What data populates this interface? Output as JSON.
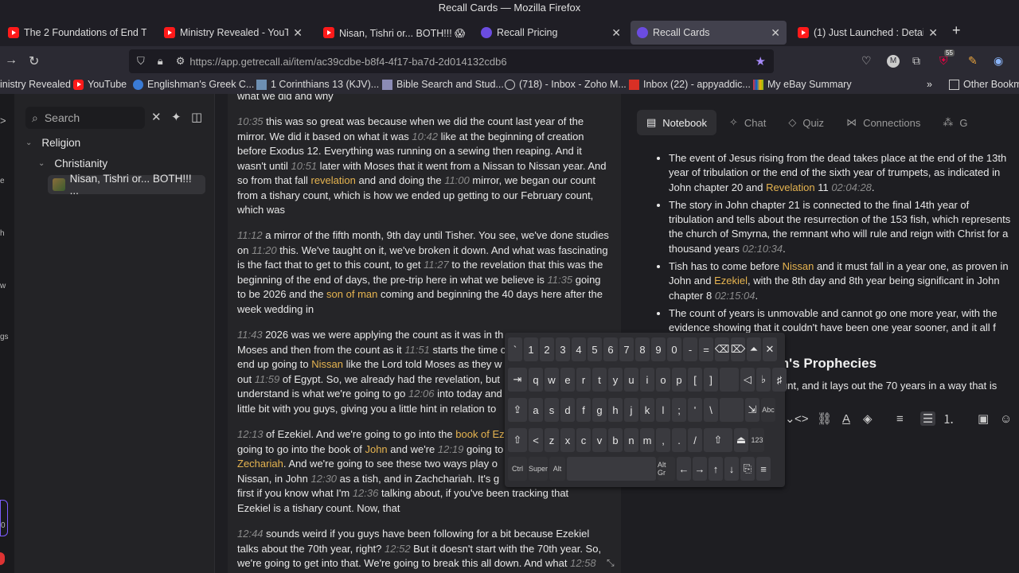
{
  "window_title": "Recall Cards — Mozilla Firefox",
  "tabs": [
    {
      "label": "The 2 Foundations of End T",
      "icon": "youtube-icon"
    },
    {
      "label": "Ministry Revealed - YouTube",
      "icon": "youtube-icon"
    },
    {
      "label": "Nisan, Tishri or... BOTH!!! 😱",
      "icon": "youtube-icon"
    },
    {
      "label": "Recall Pricing",
      "icon": "recall-icon"
    },
    {
      "label": "Recall Cards",
      "icon": "recall-icon"
    },
    {
      "label": "(1) Just Launched : Detailed",
      "icon": "youtube-icon"
    }
  ],
  "url": "https://app.getrecall.ai/item/ac39cdbe-b8f4-4f17-ba7d-2d014132cdb6",
  "bookmarks": [
    "inistry Revealed",
    "YouTube",
    "Englishman's Greek C...",
    "1 Corinthians 13 (KJV)...",
    "Bible Search and Stud...",
    "(718) - Inbox - Zoho M...",
    "Inbox (22) - appyaddic...",
    "My eBay Summary",
    "Other Bookm"
  ],
  "badge_count": "55",
  "rail_labels": [
    "e",
    "h",
    "w",
    "gs",
    "0"
  ],
  "sidebar": {
    "search_placeholder": "Search",
    "tree": [
      {
        "label": "Religion"
      },
      {
        "label": "Christianity"
      },
      {
        "label": "Nisan, Tishri or... BOTH!!! ..."
      }
    ]
  },
  "transcript": {
    "top_fragment": "what we did and why",
    "paragraphs": [
      [
        {
          "ts": "10:35"
        },
        {
          "t": " this was so great was because when we did the count last year of the mirror. We did it based on what it was "
        },
        {
          "ts": "10:42"
        },
        {
          "t": " like at the beginning of creation before Exodus 12. Everything was running on a sewing then reaping. And it wasn't until "
        },
        {
          "ts": "10:51"
        },
        {
          "t": " later with Moses that it went from a Nissan to Nissan year. And so from that fall "
        },
        {
          "hl": "revelation"
        },
        {
          "t": " and and doing the "
        },
        {
          "ts": "11:00"
        },
        {
          "t": " mirror, we began our count from a tishary count, which is how we ended up getting to our February count, which was"
        }
      ],
      [
        {
          "ts": "11:12"
        },
        {
          "t": " a mirror of the fifth month, 9th day until Tisher. You see, we've done studies on "
        },
        {
          "ts": "11:20"
        },
        {
          "t": " this. We've taught on it, we've broken it down. And what was fascinating is the fact that to get to this count, to get "
        },
        {
          "ts": "11:27"
        },
        {
          "t": " to the revelation that this was the beginning of the end of days, the pre-trip here in what we believe is "
        },
        {
          "ts": "11:35"
        },
        {
          "t": " going to be 2026 and the "
        },
        {
          "hl": "son of man"
        },
        {
          "t": " coming and beginning the 40 days here after the week wedding in"
        }
      ],
      [
        {
          "ts": "11:43"
        },
        {
          "t": " 2026 was we were applying the count as it was in th"
        },
        {
          "t": "\nMoses and then from the count as it "
        },
        {
          "ts": "11:51"
        },
        {
          "t": " starts the time c"
        },
        {
          "t": "\nend up going to "
        },
        {
          "hl": "Nissan"
        },
        {
          "t": " like the Lord told Moses as they w"
        },
        {
          "t": "\nout "
        },
        {
          "ts": "11:59"
        },
        {
          "t": " of Egypt. So, we already had the revelation, but"
        },
        {
          "t": "\nunderstand is what we're going to go "
        },
        {
          "ts": "12:06"
        },
        {
          "t": " into today and"
        },
        {
          "t": "\nlittle bit with you guys, giving you a little hint in relation to"
        }
      ],
      [
        {
          "ts": "12:13"
        },
        {
          "t": " of Ezekiel. And we're going to go into the "
        },
        {
          "hl": "book of Ez"
        },
        {
          "t": "\ngoing to go into the book of "
        },
        {
          "hl": "John"
        },
        {
          "t": " and we're "
        },
        {
          "ts": "12:19"
        },
        {
          "t": " going to"
        },
        {
          "t": "\n"
        },
        {
          "hl": "Zechariah"
        },
        {
          "t": ". And we're going to see these two ways play o"
        },
        {
          "t": "\nNissan, in John "
        },
        {
          "ts": "12:30"
        },
        {
          "t": " as a tish, and in Zachchariah. It's g"
        },
        {
          "t": "\nfirst if you know what I'm "
        },
        {
          "ts": "12:36"
        },
        {
          "t": " talking about, if you've been tracking that"
        },
        {
          "t": "\nEzekiel is a tishary count. Now, that"
        }
      ],
      [
        {
          "ts": "12:44"
        },
        {
          "t": " sounds weird if you guys have been following for a bit because Ezekiel talks about the 70th year, right? "
        },
        {
          "ts": "12:52"
        },
        {
          "t": " But it doesn't start with the 70th year. So, we're going to get into that. We're going to break this all down. And what "
        },
        {
          "ts": "12:58"
        }
      ]
    ]
  },
  "right_tabs": [
    "Notebook",
    "Chat",
    "Quiz",
    "Connections",
    "G"
  ],
  "notes": {
    "bullets": [
      [
        {
          "t": "The event of Jesus rising from the dead takes place at the end of the 13th year of tribulation or the end of the sixth year of trumpets, as indicated in John chapter 20 and "
        },
        {
          "hl": "Revelation"
        },
        {
          "t": " 11 "
        },
        {
          "ts": "02:04:28"
        },
        {
          "t": "."
        }
      ],
      [
        {
          "t": "The story in John chapter 21 is connected to the final 14th year of tribulation and tells about the resurrection of the 153 fish, which represents the church of Smyrna, the remnant who will rule and reign with Christ for a thousand years "
        },
        {
          "ts": "02:10:34"
        },
        {
          "t": "."
        }
      ],
      [
        {
          "t": "Tish has to come before "
        },
        {
          "hl": "Nissan"
        },
        {
          "t": " and it must fall in a year one, as proven in John and "
        },
        {
          "hl": "Ezekiel"
        },
        {
          "t": ", with the 8th day and 8th year being significant in John chapter 8 "
        },
        {
          "ts": "02:15:04"
        },
        {
          "t": "."
        }
      ],
      [
        {
          "t": "The count of years is unmovable and cannot go one more year, with the evidence showing that it couldn't have been one year sooner, and it all "
        },
        {
          "t": "f Christ "
        },
        {
          "ts": "02:16:40"
        },
        {
          "t": "."
        }
      ]
    ],
    "heading": "riah's Prophecies",
    "after_heading": "unt, and it lays out the 70 years in a way that is"
  },
  "keyboard": {
    "rows": [
      [
        "`",
        "1",
        "2",
        "3",
        "4",
        "5",
        "6",
        "7",
        "8",
        "9",
        "0",
        "-",
        "=",
        "⌫",
        "⌦",
        "⏶",
        "✕"
      ],
      [
        "⇥",
        "q",
        "w",
        "e",
        "r",
        "t",
        "y",
        "u",
        "i",
        "o",
        "p",
        "[",
        "]",
        "",
        "◁",
        "♭",
        "♯"
      ],
      [
        "⇪",
        "a",
        "s",
        "d",
        "f",
        "g",
        "h",
        "j",
        "k",
        "l",
        ";",
        "'",
        "\\",
        "",
        "⇲",
        "Abc"
      ],
      [
        "⇧",
        "<",
        "z",
        "x",
        "c",
        "v",
        "b",
        "n",
        "m",
        ",",
        ".",
        "/",
        "⇧",
        "⏏",
        "123"
      ],
      [
        "Ctrl",
        "Super",
        "Alt",
        "",
        "Alt Gr",
        "←",
        "→",
        "↑",
        "↓",
        "⎘",
        "≡"
      ]
    ]
  }
}
